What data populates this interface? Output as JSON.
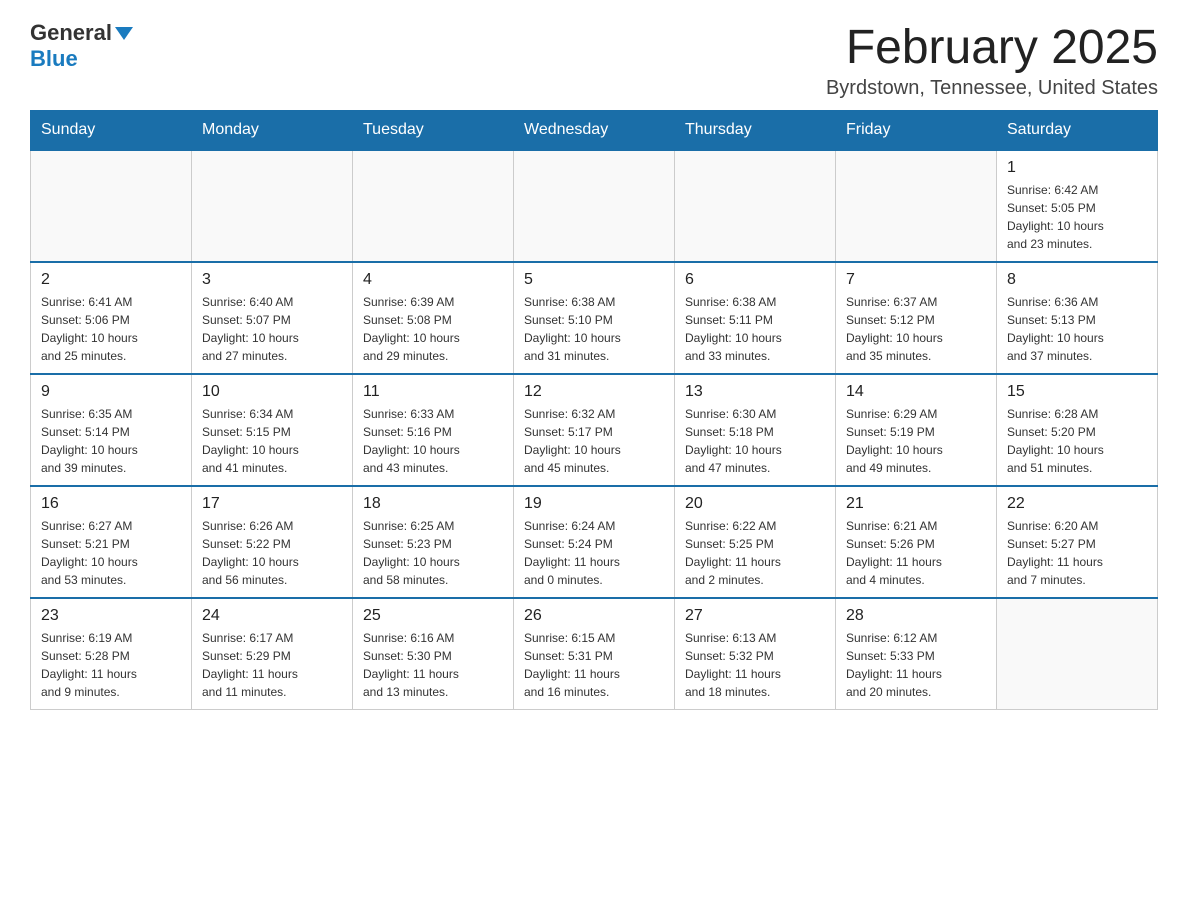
{
  "header": {
    "logo_general": "General",
    "logo_blue": "Blue",
    "month_title": "February 2025",
    "location": "Byrdstown, Tennessee, United States"
  },
  "days_of_week": [
    "Sunday",
    "Monday",
    "Tuesday",
    "Wednesday",
    "Thursday",
    "Friday",
    "Saturday"
  ],
  "weeks": [
    {
      "days": [
        {
          "num": "",
          "info": ""
        },
        {
          "num": "",
          "info": ""
        },
        {
          "num": "",
          "info": ""
        },
        {
          "num": "",
          "info": ""
        },
        {
          "num": "",
          "info": ""
        },
        {
          "num": "",
          "info": ""
        },
        {
          "num": "1",
          "info": "Sunrise: 6:42 AM\nSunset: 5:05 PM\nDaylight: 10 hours\nand 23 minutes."
        }
      ]
    },
    {
      "days": [
        {
          "num": "2",
          "info": "Sunrise: 6:41 AM\nSunset: 5:06 PM\nDaylight: 10 hours\nand 25 minutes."
        },
        {
          "num": "3",
          "info": "Sunrise: 6:40 AM\nSunset: 5:07 PM\nDaylight: 10 hours\nand 27 minutes."
        },
        {
          "num": "4",
          "info": "Sunrise: 6:39 AM\nSunset: 5:08 PM\nDaylight: 10 hours\nand 29 minutes."
        },
        {
          "num": "5",
          "info": "Sunrise: 6:38 AM\nSunset: 5:10 PM\nDaylight: 10 hours\nand 31 minutes."
        },
        {
          "num": "6",
          "info": "Sunrise: 6:38 AM\nSunset: 5:11 PM\nDaylight: 10 hours\nand 33 minutes."
        },
        {
          "num": "7",
          "info": "Sunrise: 6:37 AM\nSunset: 5:12 PM\nDaylight: 10 hours\nand 35 minutes."
        },
        {
          "num": "8",
          "info": "Sunrise: 6:36 AM\nSunset: 5:13 PM\nDaylight: 10 hours\nand 37 minutes."
        }
      ]
    },
    {
      "days": [
        {
          "num": "9",
          "info": "Sunrise: 6:35 AM\nSunset: 5:14 PM\nDaylight: 10 hours\nand 39 minutes."
        },
        {
          "num": "10",
          "info": "Sunrise: 6:34 AM\nSunset: 5:15 PM\nDaylight: 10 hours\nand 41 minutes."
        },
        {
          "num": "11",
          "info": "Sunrise: 6:33 AM\nSunset: 5:16 PM\nDaylight: 10 hours\nand 43 minutes."
        },
        {
          "num": "12",
          "info": "Sunrise: 6:32 AM\nSunset: 5:17 PM\nDaylight: 10 hours\nand 45 minutes."
        },
        {
          "num": "13",
          "info": "Sunrise: 6:30 AM\nSunset: 5:18 PM\nDaylight: 10 hours\nand 47 minutes."
        },
        {
          "num": "14",
          "info": "Sunrise: 6:29 AM\nSunset: 5:19 PM\nDaylight: 10 hours\nand 49 minutes."
        },
        {
          "num": "15",
          "info": "Sunrise: 6:28 AM\nSunset: 5:20 PM\nDaylight: 10 hours\nand 51 minutes."
        }
      ]
    },
    {
      "days": [
        {
          "num": "16",
          "info": "Sunrise: 6:27 AM\nSunset: 5:21 PM\nDaylight: 10 hours\nand 53 minutes."
        },
        {
          "num": "17",
          "info": "Sunrise: 6:26 AM\nSunset: 5:22 PM\nDaylight: 10 hours\nand 56 minutes."
        },
        {
          "num": "18",
          "info": "Sunrise: 6:25 AM\nSunset: 5:23 PM\nDaylight: 10 hours\nand 58 minutes."
        },
        {
          "num": "19",
          "info": "Sunrise: 6:24 AM\nSunset: 5:24 PM\nDaylight: 11 hours\nand 0 minutes."
        },
        {
          "num": "20",
          "info": "Sunrise: 6:22 AM\nSunset: 5:25 PM\nDaylight: 11 hours\nand 2 minutes."
        },
        {
          "num": "21",
          "info": "Sunrise: 6:21 AM\nSunset: 5:26 PM\nDaylight: 11 hours\nand 4 minutes."
        },
        {
          "num": "22",
          "info": "Sunrise: 6:20 AM\nSunset: 5:27 PM\nDaylight: 11 hours\nand 7 minutes."
        }
      ]
    },
    {
      "days": [
        {
          "num": "23",
          "info": "Sunrise: 6:19 AM\nSunset: 5:28 PM\nDaylight: 11 hours\nand 9 minutes."
        },
        {
          "num": "24",
          "info": "Sunrise: 6:17 AM\nSunset: 5:29 PM\nDaylight: 11 hours\nand 11 minutes."
        },
        {
          "num": "25",
          "info": "Sunrise: 6:16 AM\nSunset: 5:30 PM\nDaylight: 11 hours\nand 13 minutes."
        },
        {
          "num": "26",
          "info": "Sunrise: 6:15 AM\nSunset: 5:31 PM\nDaylight: 11 hours\nand 16 minutes."
        },
        {
          "num": "27",
          "info": "Sunrise: 6:13 AM\nSunset: 5:32 PM\nDaylight: 11 hours\nand 18 minutes."
        },
        {
          "num": "28",
          "info": "Sunrise: 6:12 AM\nSunset: 5:33 PM\nDaylight: 11 hours\nand 20 minutes."
        },
        {
          "num": "",
          "info": ""
        }
      ]
    }
  ]
}
